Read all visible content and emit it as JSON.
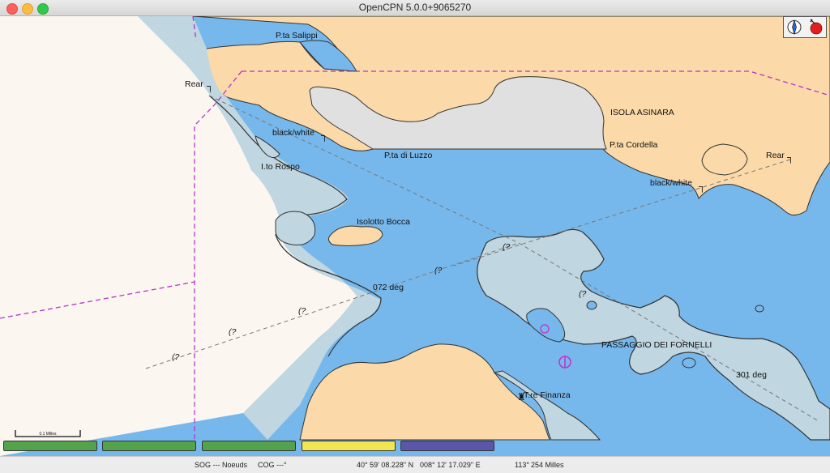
{
  "window": {
    "title": "OpenCPN 5.0.0+9065270"
  },
  "chart": {
    "labels": {
      "salippi": "P.ta Salippi",
      "rear_left": "Rear",
      "black_white_left": "black/white",
      "rospo": "I.to Rospo",
      "luzzo": "P.ta di Luzzo",
      "asinara": "ISOLA ASINARA",
      "cordella": "P.ta Cordella",
      "rear_right": "Rear",
      "black_white_right": "black/white",
      "bocca": "Isolotto Bocca",
      "deg072": "072 deg",
      "fornelli": "PASSAGGIO DEI FORNELLI",
      "deg301": "301 deg",
      "finanza": "T.re Finanza",
      "q1": "(?",
      "q2": "(?",
      "q3": "(?",
      "q4": "(?",
      "q5": "(?",
      "q6": "(?"
    },
    "scale_label": "0.1 Milles",
    "colors": {
      "land": "#fbd9a9",
      "deep_water": "#77b8ec",
      "shallow_water": "#c0d6e0",
      "unsurveyed": "#fcf6f1",
      "island_grey": "#e0e0e0",
      "boundary": "#b336c7"
    }
  },
  "compass": {
    "icon": "compass-icon",
    "record_icon": "record-icon"
  },
  "piano_keys": [
    {
      "color": "#54a24b"
    },
    {
      "color": "#54a24b"
    },
    {
      "color": "#54a24b"
    },
    {
      "color": "#f2e552"
    },
    {
      "color": "#5c56a8"
    }
  ],
  "status": {
    "sog": "SOG --- Noeuds",
    "cog": "COG ---°",
    "lat": "40° 59' 08.228\" N",
    "lon": "008° 12' 17.029\" E",
    "bearing": "113°",
    "distance": "254 Milles"
  }
}
